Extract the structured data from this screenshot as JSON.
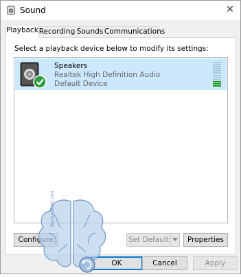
{
  "window": {
    "title": "Sound",
    "close_glyph": "✕"
  },
  "tabs": [
    {
      "label": "Playback",
      "active": true
    },
    {
      "label": "Recording",
      "active": false
    },
    {
      "label": "Sounds",
      "active": false
    },
    {
      "label": "Communications",
      "active": false
    }
  ],
  "panel": {
    "instructions": "Select a playback device below to modify its settings:"
  },
  "devices": [
    {
      "name": "Speakers",
      "driver": "Realtek High Definition Audio",
      "status": "Default Device",
      "icon": "speaker-icon",
      "status_icon": "check-icon",
      "level": 0.25
    }
  ],
  "panel_buttons": {
    "configure": "Configure",
    "set_default": "Set Default",
    "properties": "Properties"
  },
  "dialog_buttons": {
    "ok": "OK",
    "cancel": "Cancel",
    "apply": "Apply"
  },
  "watermark": "BackupBrain.com",
  "colors": {
    "selection": "#cce8ff",
    "accent": "#0078d7",
    "meter_active": "#1f9d1f",
    "meter_idle": "#a7c9d6"
  }
}
